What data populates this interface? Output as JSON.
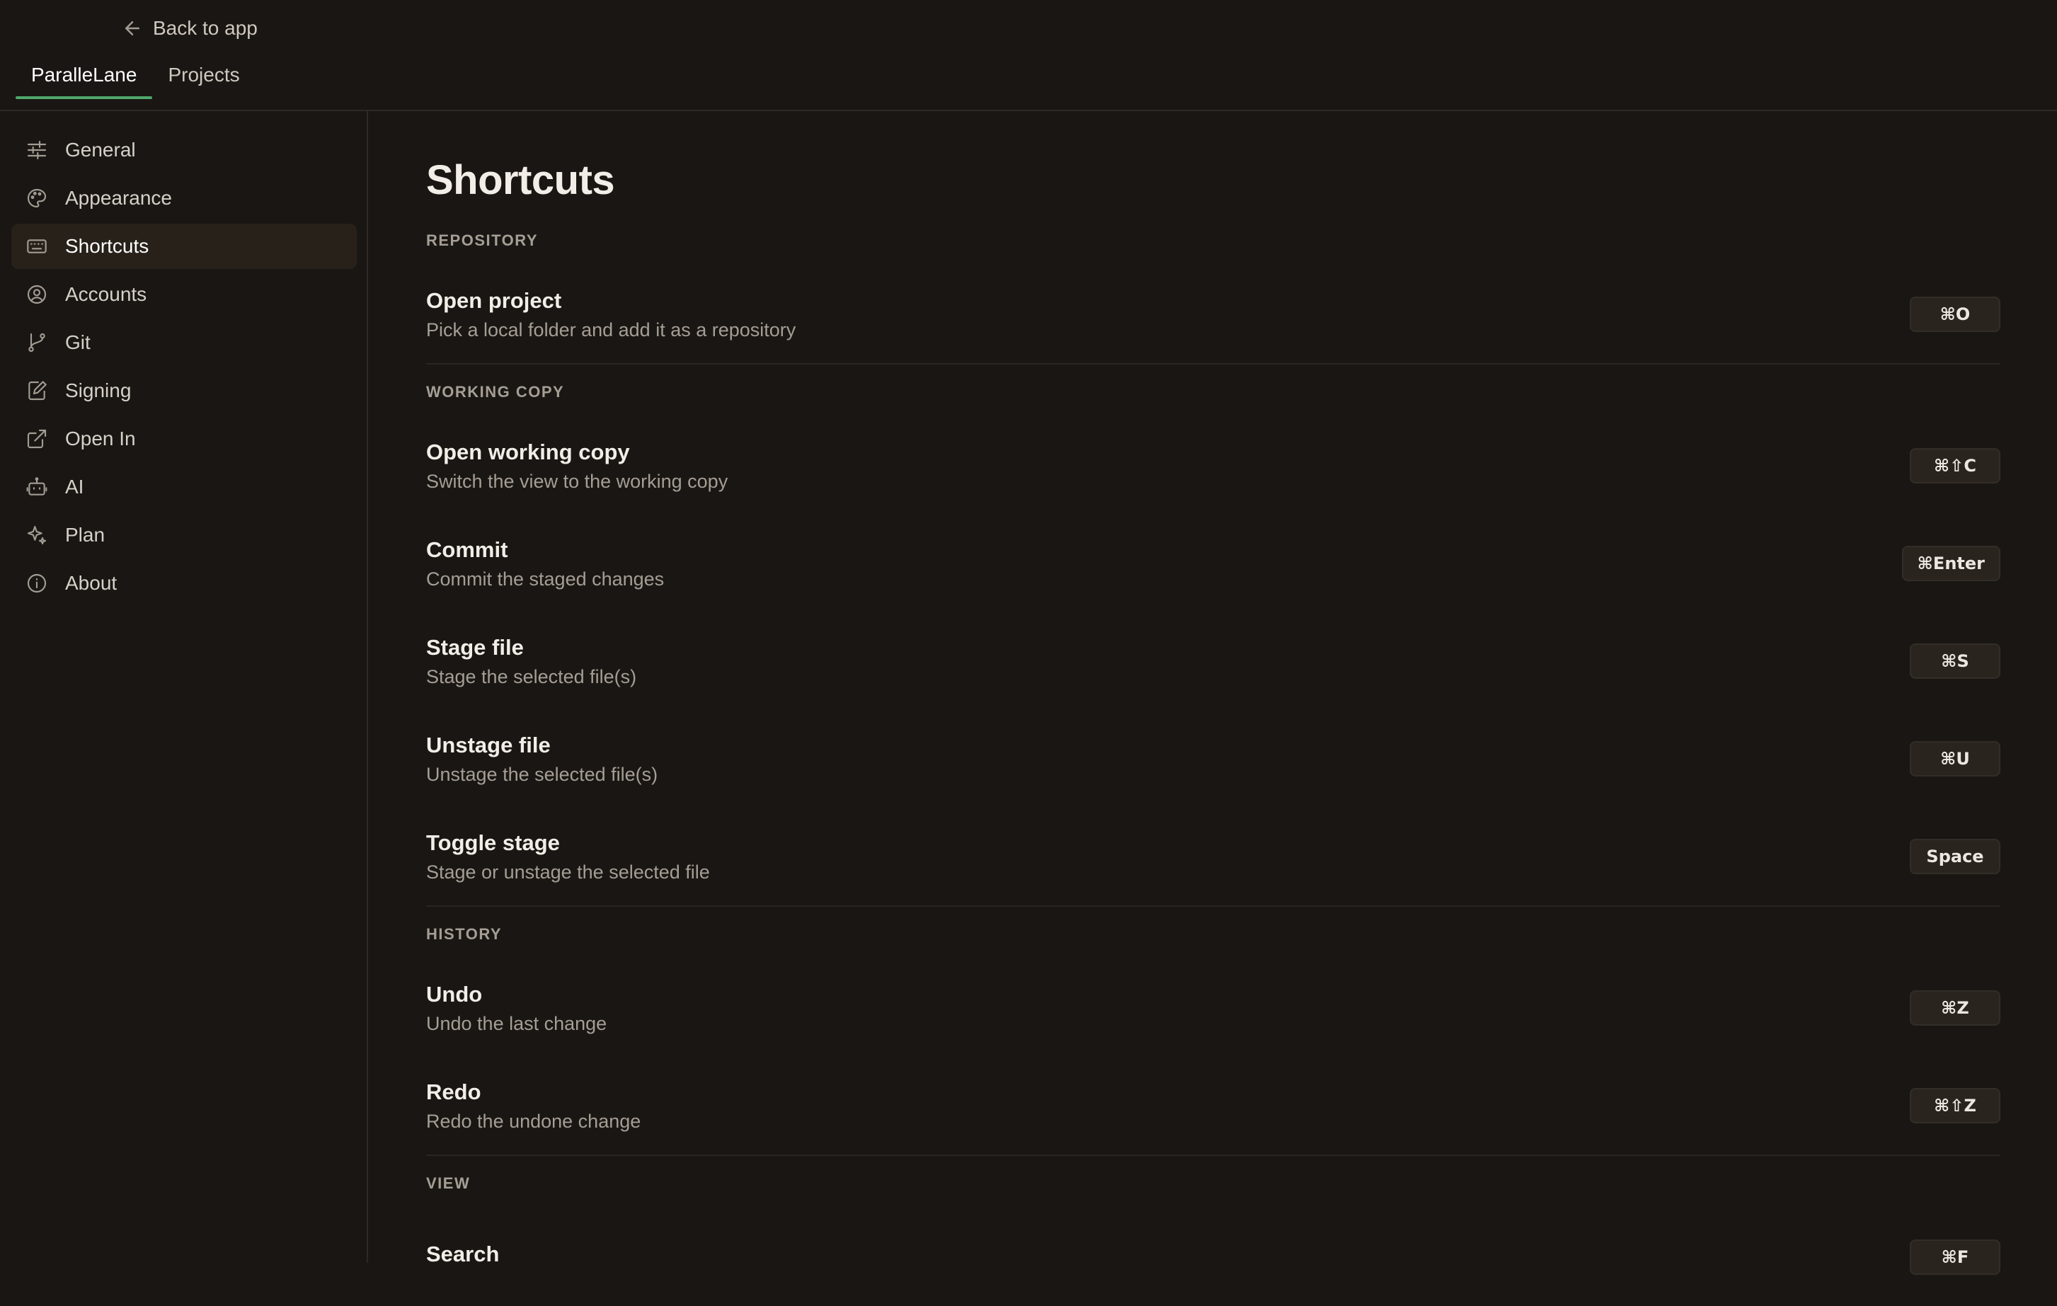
{
  "header": {
    "back_label": "Back to app",
    "tabs": [
      {
        "label": "ParalleLane",
        "active": true
      },
      {
        "label": "Projects",
        "active": false
      }
    ]
  },
  "sidebar": {
    "items": [
      {
        "label": "General",
        "icon": "sliders-icon"
      },
      {
        "label": "Appearance",
        "icon": "palette-icon"
      },
      {
        "label": "Shortcuts",
        "icon": "keyboard-icon",
        "active": true
      },
      {
        "label": "Accounts",
        "icon": "user-circle-icon"
      },
      {
        "label": "Git",
        "icon": "git-branch-icon"
      },
      {
        "label": "Signing",
        "icon": "signature-icon"
      },
      {
        "label": "Open In",
        "icon": "external-link-icon"
      },
      {
        "label": "AI",
        "icon": "robot-icon"
      },
      {
        "label": "Plan",
        "icon": "sparkles-icon"
      },
      {
        "label": "About",
        "icon": "info-icon"
      }
    ]
  },
  "main": {
    "title": "Shortcuts",
    "sections": [
      {
        "title": "REPOSITORY",
        "rows": [
          {
            "label": "Open project",
            "desc": "Pick a local folder and add it as a repository",
            "key": "⌘O"
          }
        ]
      },
      {
        "title": "WORKING COPY",
        "rows": [
          {
            "label": "Open working copy",
            "desc": "Switch the view to the working copy",
            "key": "⌘⇧C"
          },
          {
            "label": "Commit",
            "desc": "Commit the staged changes",
            "key": "⌘Enter"
          },
          {
            "label": "Stage file",
            "desc": "Stage the selected file(s)",
            "key": "⌘S"
          },
          {
            "label": "Unstage file",
            "desc": "Unstage the selected file(s)",
            "key": "⌘U"
          },
          {
            "label": "Toggle stage",
            "desc": "Stage or unstage the selected file",
            "key": "Space"
          }
        ]
      },
      {
        "title": "HISTORY",
        "rows": [
          {
            "label": "Undo",
            "desc": "Undo the last change",
            "key": "⌘Z"
          },
          {
            "label": "Redo",
            "desc": "Redo the undone change",
            "key": "⌘⇧Z"
          }
        ]
      },
      {
        "title": "VIEW",
        "rows": [
          {
            "label": "Search",
            "desc": "",
            "key": "⌘F"
          }
        ]
      }
    ]
  },
  "colors": {
    "background": "#1a1613",
    "accent": "#4ea86a",
    "active_item_bg": "#272119"
  }
}
